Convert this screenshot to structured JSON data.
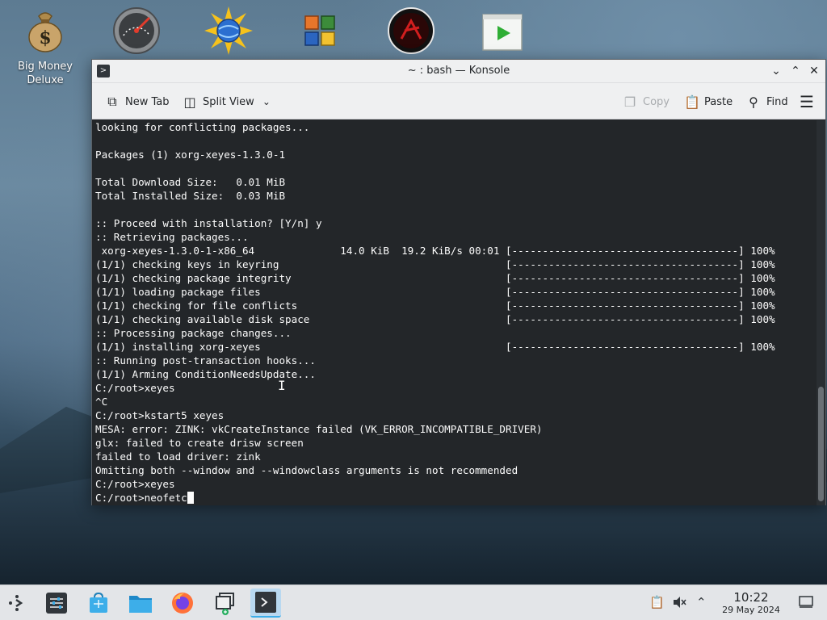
{
  "desktop": {
    "icons": [
      {
        "label": "Big Money\nDeluxe",
        "icon": "money-bag-icon"
      },
      {
        "label": "",
        "icon": "gauge-icon"
      },
      {
        "label": "",
        "icon": "sun-globe-icon"
      },
      {
        "label": "",
        "icon": "office-squares-icon"
      },
      {
        "label": "",
        "icon": "red-orb-icon"
      },
      {
        "label": "",
        "icon": "play-window-icon"
      }
    ]
  },
  "window": {
    "title": "~ : bash — Konsole",
    "controls": [
      "minimize",
      "maximize",
      "close"
    ]
  },
  "toolbar": {
    "new_tab": "New Tab",
    "split_view": "Split View",
    "copy": "Copy",
    "paste": "Paste",
    "find": "Find"
  },
  "terminal": {
    "lines": [
      "looking for conflicting packages...",
      "",
      "Packages (1) xorg-xeyes-1.3.0-1",
      "",
      "Total Download Size:   0.01 MiB",
      "Total Installed Size:  0.03 MiB",
      "",
      ":: Proceed with installation? [Y/n] y",
      ":: Retrieving packages...",
      " xorg-xeyes-1.3.0-1-x86_64              14.0 KiB  19.2 KiB/s 00:01 [-------------------------------------] 100%",
      "(1/1) checking keys in keyring                                     [-------------------------------------] 100%",
      "(1/1) checking package integrity                                   [-------------------------------------] 100%",
      "(1/1) loading package files                                        [-------------------------------------] 100%",
      "(1/1) checking for file conflicts                                  [-------------------------------------] 100%",
      "(1/1) checking available disk space                                [-------------------------------------] 100%",
      ":: Processing package changes...",
      "(1/1) installing xorg-xeyes                                        [-------------------------------------] 100%",
      ":: Running post-transaction hooks...",
      "(1/1) Arming ConditionNeedsUpdate...",
      "C:/root>xeyes",
      "^C",
      "C:/root>kstart5 xeyes",
      "MESA: error: ZINK: vkCreateInstance failed (VK_ERROR_INCOMPATIBLE_DRIVER)",
      "glx: failed to create drisw screen",
      "failed to load driver: zink",
      "Omitting both --window and --windowclass arguments is not recommended",
      "C:/root>xeyes"
    ],
    "prompt": "C:/root>neofetc"
  },
  "taskbar": {
    "clock_time": "10:22",
    "clock_date": "29 May 2024"
  },
  "colors": {
    "terminal_bg": "#232629",
    "terminal_fg": "#fcfcfc",
    "chrome_bg": "#eff0f1",
    "accent": "#3daee9"
  }
}
